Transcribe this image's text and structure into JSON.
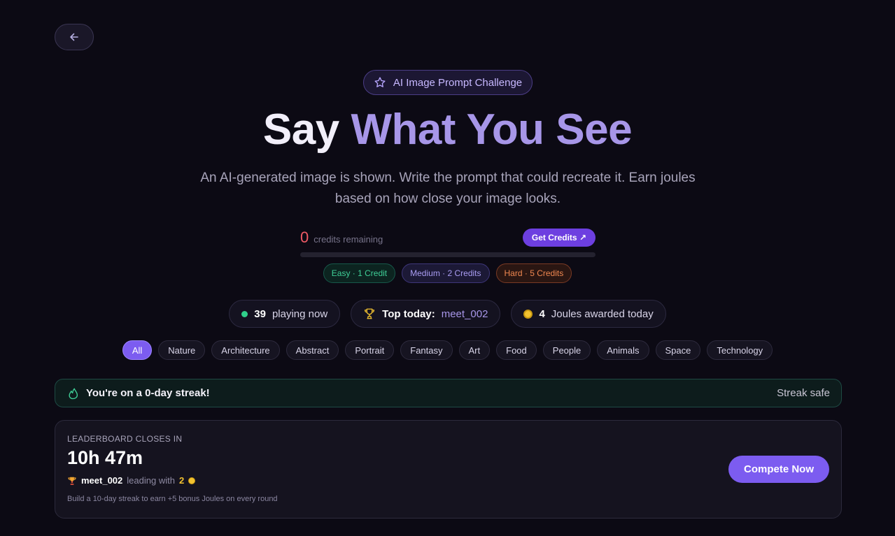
{
  "badge": {
    "label": "AI Image Prompt Challenge",
    "icon": "star-icon"
  },
  "hero": {
    "title_part1": "Say",
    "title_part2": "What You See",
    "subtitle": "An AI-generated image is shown. Write the prompt that could recreate it. Earn joules based on how close your image looks."
  },
  "credits": {
    "count": "0",
    "label": "credits remaining",
    "button": "Get Credits ↗",
    "progress_fraction": 0
  },
  "difficulties": [
    {
      "label": "Easy · 1 Credit",
      "level": "easy"
    },
    {
      "label": "Medium · 2 Credits",
      "level": "medium"
    },
    {
      "label": "Hard · 5 Credits",
      "level": "hard"
    }
  ],
  "stats": {
    "playing_count": "39",
    "playing_label": "playing now",
    "top_label": "Top today:",
    "top_user": "meet_002",
    "joules_count": "4",
    "joules_label": "Joules awarded today"
  },
  "categories": [
    "All",
    "Nature",
    "Architecture",
    "Abstract",
    "Portrait",
    "Fantasy",
    "Art",
    "Food",
    "People",
    "Animals",
    "Space",
    "Technology"
  ],
  "active_category": "All",
  "streak": {
    "text": "You're on a 0-day streak!",
    "status": "Streak safe"
  },
  "leaderboard": {
    "label": "LEADERBOARD CLOSES IN",
    "time": "10h 47m",
    "leader": "meet_002",
    "leading_with": "leading with",
    "points": "2",
    "note": "Build a 10-day streak to earn +5 bonus Joules on every round",
    "button": "Compete Now"
  },
  "colors": {
    "accent": "#7c5cf0",
    "background": "#0c0a14",
    "easy": "#3fcf97",
    "medium": "#a99cf2",
    "hard": "#f08750",
    "credits_zero": "#ef5a65"
  }
}
